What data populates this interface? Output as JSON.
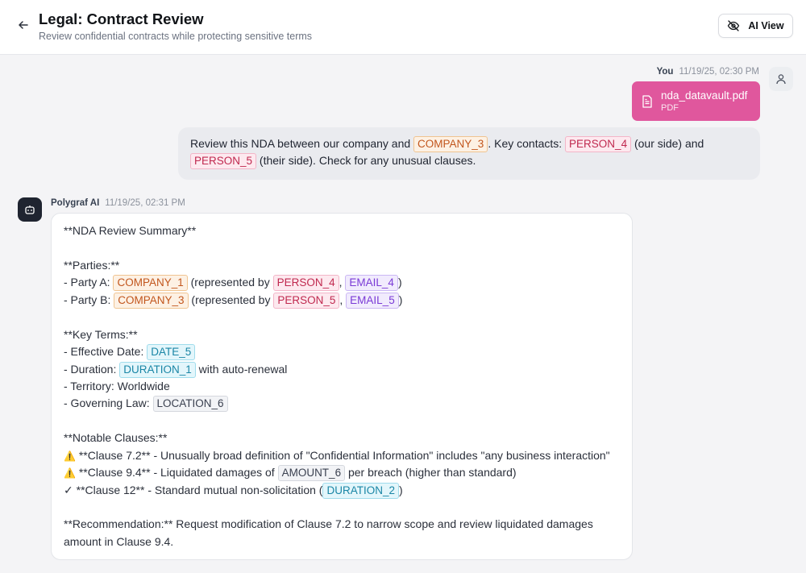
{
  "header": {
    "title": "Legal: Contract Review",
    "subtitle": "Review confidential contracts while protecting sensitive terms",
    "ai_view_label": "AI View"
  },
  "user_message": {
    "sender": "You",
    "timestamp": "11/19/25, 02:30 PM",
    "attachment": {
      "name": "nda_datavault.pdf",
      "type": "PDF"
    },
    "text": {
      "p1": "Review this NDA between our company and ",
      "t1": "COMPANY_3",
      "p2": ". Key contacts: ",
      "t2": "PERSON_4",
      "p3": " (our side) and",
      "t3": "PERSON_5",
      "p4": " (their side). Check for any unusual clauses."
    }
  },
  "ai_message": {
    "sender": "Polygraf AI",
    "timestamp": "11/19/25, 02:31 PM",
    "summary_heading": "**NDA Review Summary**",
    "parties_heading": "**Parties:**",
    "party_a": {
      "prefix": "- Party A: ",
      "company": "COMPANY_1",
      "mid": " (represented by ",
      "person": "PERSON_4",
      "comma": ", ",
      "email": "EMAIL_4",
      "end": ")"
    },
    "party_b": {
      "prefix": "- Party B: ",
      "company": "COMPANY_3",
      "mid": " (represented by ",
      "person": "PERSON_5",
      "comma": ", ",
      "email": "EMAIL_5",
      "end": ")"
    },
    "key_terms_heading": "**Key Terms:**",
    "effective_date": {
      "prefix": "- Effective Date: ",
      "token": "DATE_5"
    },
    "duration": {
      "prefix": "- Duration: ",
      "token": "DURATION_1",
      "suffix": " with auto-renewal"
    },
    "territory": "- Territory: Worldwide",
    "governing_law": {
      "prefix": "- Governing Law: ",
      "token": "LOCATION_6"
    },
    "notable_heading": "**Notable Clauses:**",
    "clause_72": {
      "icon": "⚠️",
      "text": " **Clause 7.2** - Unusually broad definition of \"Confidential Information\" includes \"any business interaction\""
    },
    "clause_94": {
      "icon": "⚠️",
      "prefix": " **Clause 9.4** - Liquidated damages of ",
      "token": "AMOUNT_6",
      "suffix": " per breach (higher than standard)"
    },
    "clause_12": {
      "icon": "✓",
      "prefix": " **Clause 12** - Standard mutual non-solicitation (",
      "token": "DURATION_2",
      "suffix": ")"
    },
    "recommendation": "**Recommendation:** Request modification of Clause 7.2 to narrow scope and review liquidated damages amount in Clause 9.4."
  },
  "icons": {
    "back": "arrow-left-icon",
    "ai_view": "eye-off-icon",
    "user_avatar": "user-icon",
    "bot_avatar": "bot-icon",
    "file": "file-text-icon"
  },
  "colors": {
    "file_card": "#e0579d",
    "company_token": "#c2561d",
    "person_token": "#c0294f",
    "email_token": "#7a3ad6",
    "date_token": "#1a86a6",
    "bot_avatar": "#1f2430"
  }
}
